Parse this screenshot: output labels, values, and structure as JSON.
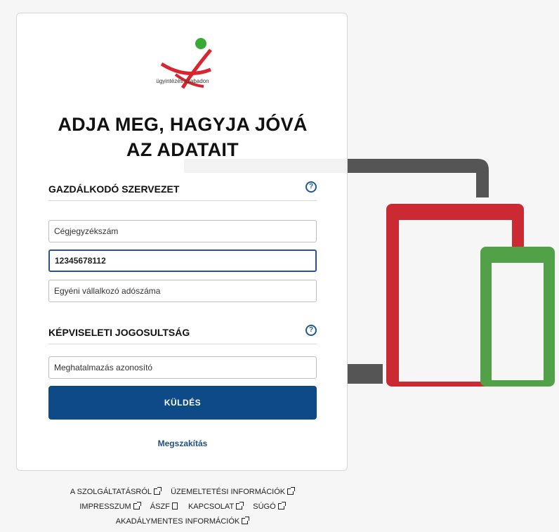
{
  "logo": {
    "caption": "ügyintézés szabadon",
    "colors": {
      "dot": "#3aa935",
      "mark": "#d9262e"
    }
  },
  "title": {
    "line1": "ADJA MEG, HAGYJA JÓVÁ",
    "line2": "AZ ADATAIT"
  },
  "sections": {
    "organization": {
      "heading": "GAZDÁLKODÓ SZERVEZET",
      "help": "?"
    },
    "representation": {
      "heading": "KÉPVISELETI JOGOSULTSÁG",
      "help": "?"
    }
  },
  "fields": {
    "company_reg": {
      "placeholder": "Cégjegyzékszám",
      "value": ""
    },
    "tax_number": {
      "placeholder": "",
      "value": "12345678112"
    },
    "entrepreneur_tax": {
      "placeholder": "Egyéni vállalkozó adószáma",
      "value": ""
    },
    "authorization_id": {
      "placeholder": "Meghatalmazás azonosító",
      "value": ""
    }
  },
  "actions": {
    "submit": "KÜLDÉS",
    "cancel": "Megszakítás"
  },
  "footer": {
    "about": "A SZOLGÁLTATÁSRÓL",
    "operations": "ÜZEMELTETÉSI INFORMÁCIÓK",
    "imprint": "IMPRESSZUM",
    "terms": "ÁSZF",
    "contact": "KAPCSOLAT",
    "help": "SÚGÓ",
    "accessibility": "AKADÁLYMENTES INFORMÁCIÓK"
  },
  "colors": {
    "primary": "#0d4a87",
    "device_gray": "#555555",
    "device_red": "#cc2a33",
    "device_green": "#52a047"
  }
}
